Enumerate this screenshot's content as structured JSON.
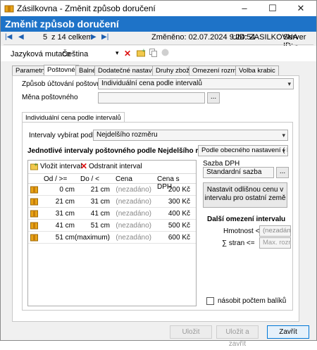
{
  "window": {
    "title": "Zásilkovna - Změnit způsob doručení"
  },
  "header": {
    "title": "Změnit způsob doručení"
  },
  "navbar": {
    "position": "5",
    "of_label": "z 14 celkem",
    "changed_label": "Změněno: 02.07.2024 9:24:54",
    "uid_label": "UID: ZASILKOVNA",
    "server_label": "Server ID: -"
  },
  "toolbar": {
    "language_label": "Jazyková mutace",
    "language_value": "Čeština"
  },
  "tabs": [
    "Parametry",
    "Poštovné",
    "Balné",
    "Dodatečné nastavení",
    "Druhy zboží",
    "Omezení rozměrů",
    "Volba krabic"
  ],
  "postage": {
    "method_label": "Způsob účtování poštovného",
    "method_value": "Individuální cena podle intervalů",
    "currency_label": "Měna poštovného",
    "currency_value": "",
    "currency_btn": "..."
  },
  "subtab": {
    "label": "Individuální cena podle intervalů"
  },
  "intervals": {
    "select_label": "Intervaly vybírat podle",
    "select_value": "Nejdelšího rozměru",
    "section_title": "Jednotlivé intervaly poštovného podle Nejdelšího rozměru",
    "settings_value": "Podle obecného nastavení ( MIN",
    "add_label": "Vložit interval",
    "remove_label": "Odstranit interval",
    "columns": [
      "Od / >=",
      "Do / <",
      "Cena",
      "Cena s DPH"
    ],
    "rows": [
      [
        "0 cm",
        "21 cm",
        "(nezadáno)",
        "200 Kč"
      ],
      [
        "21 cm",
        "31 cm",
        "(nezadáno)",
        "300 Kč"
      ],
      [
        "31 cm",
        "41 cm",
        "(nezadáno)",
        "400 Kč"
      ],
      [
        "41 cm",
        "51 cm",
        "(nezadáno)",
        "500 Kč"
      ],
      [
        "51 cm",
        "(maximum)",
        "(nezadáno)",
        "600 Kč"
      ]
    ]
  },
  "vat": {
    "label": "Sazba DPH",
    "value": "Standardní sazba",
    "btn": "...",
    "other_country_btn_line1": "Nastavit odlišnou cenu v",
    "other_country_btn_line2": "intervalu pro ostatní země"
  },
  "limits": {
    "title": "Další omezení intervalu",
    "weight_label": "Hmotnost <=",
    "weight_value": "(nezadáno)",
    "sides_label": "∑ stran <=",
    "sides_placeholder": "Max. rozměr"
  },
  "multiply": {
    "label": "násobit počtem balíků"
  },
  "footer": {
    "save": "Uložit",
    "save_close": "Uložit a zavřít",
    "close": "Zavřít"
  },
  "colors": {
    "header": "#1e73c8",
    "nav_accent": "#1e5fb0",
    "row_icon": "#e8a317"
  }
}
